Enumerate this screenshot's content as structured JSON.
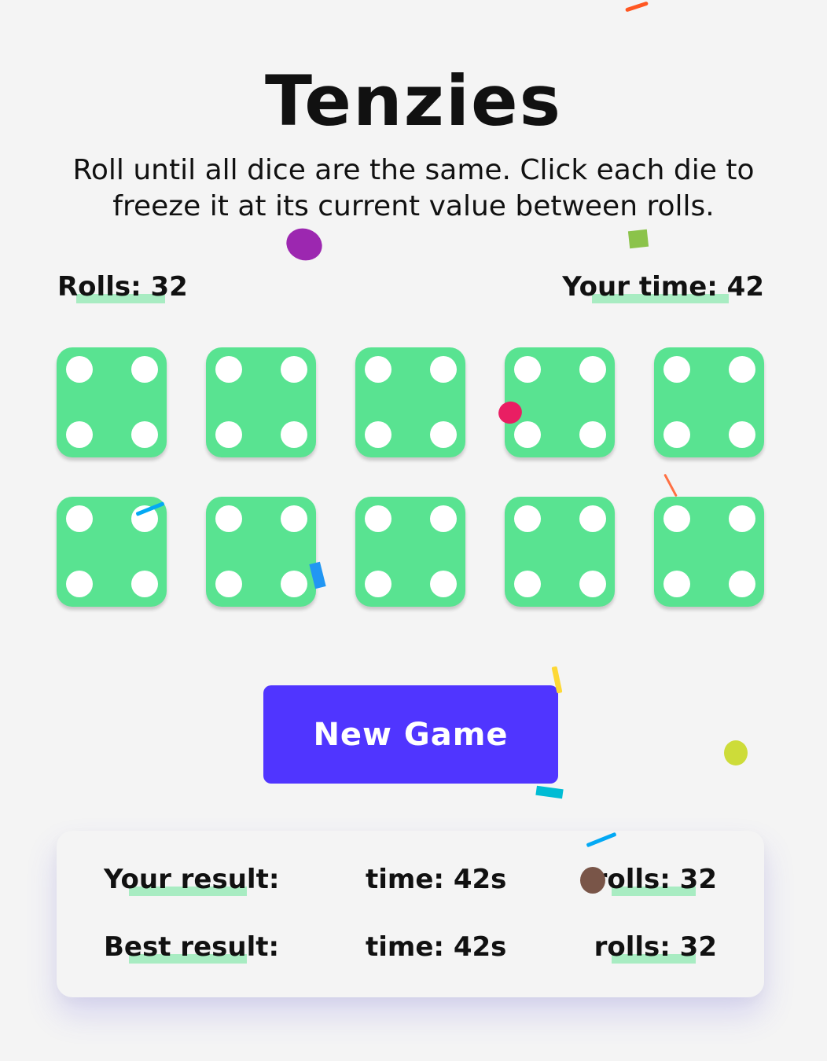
{
  "app": {
    "title": "Tenzies",
    "instructions": "Roll until all dice are the same. Click each die to freeze it at its current value between rolls."
  },
  "stats": {
    "rolls_label": "Rolls: 32",
    "rolls_value": 32,
    "time_label": "Your time: 42",
    "time_value": 42
  },
  "dice": [
    {
      "value": 4,
      "held": true
    },
    {
      "value": 4,
      "held": true
    },
    {
      "value": 4,
      "held": true
    },
    {
      "value": 4,
      "held": true
    },
    {
      "value": 4,
      "held": true
    },
    {
      "value": 4,
      "held": true
    },
    {
      "value": 4,
      "held": true
    },
    {
      "value": 4,
      "held": true
    },
    {
      "value": 4,
      "held": true
    },
    {
      "value": 4,
      "held": true
    }
  ],
  "actions": {
    "new_game_label": "New Game"
  },
  "results": {
    "your": {
      "label": "Your result:",
      "time": "time: 42s",
      "rolls": "rolls: 32"
    },
    "best": {
      "label": "Best result:",
      "time": "time: 42s",
      "rolls": "rolls: 32"
    }
  },
  "colors": {
    "background": "#f4f4f4",
    "die_held": "#59e391",
    "pip": "#ffffff",
    "button": "#5035ff",
    "button_text": "#ffffff",
    "highlight": "#a8ecc2",
    "text": "#111111"
  },
  "decorations": {
    "confetti_colors": [
      "#ff5722",
      "#9c27b0",
      "#8bc34a",
      "#e91e63",
      "#03a9f4",
      "#ff7043",
      "#2196f3",
      "#fdd835",
      "#cddc39",
      "#00bcd4",
      "#795548"
    ]
  }
}
